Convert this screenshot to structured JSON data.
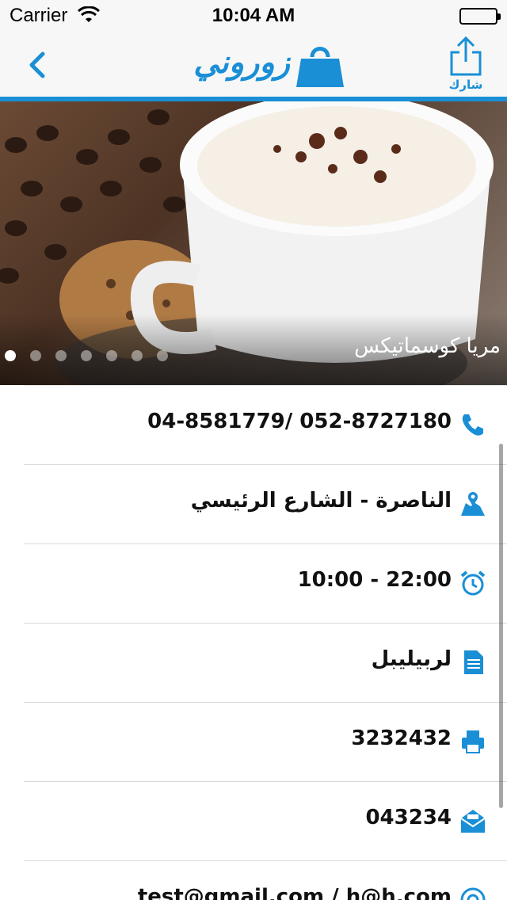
{
  "status_bar": {
    "carrier": "Carrier",
    "time": "10:04 AM"
  },
  "nav": {
    "logo_text": "زوروني",
    "share_label": "شارك"
  },
  "hero": {
    "caption": "مريا كوسماتيكس",
    "slide_count": 7,
    "active_slide": 1
  },
  "details": [
    {
      "icon": "phone-icon",
      "text": "04-8581779/ 052-8727180"
    },
    {
      "icon": "map-icon",
      "text": "الناصرة - الشارع الرئيسي"
    },
    {
      "icon": "alarm-clock-icon",
      "text": "10:00 - 22:00"
    },
    {
      "icon": "document-icon",
      "text": "لربيليبل"
    },
    {
      "icon": "fax-icon",
      "text": "3232432"
    },
    {
      "icon": "envelope-icon",
      "text": "043234"
    },
    {
      "icon": "email-at-icon",
      "text": "test@gmail.com / h@h.com"
    }
  ],
  "colors": {
    "accent": "#1a8fd6",
    "nav_background": "#f7f7f7"
  }
}
